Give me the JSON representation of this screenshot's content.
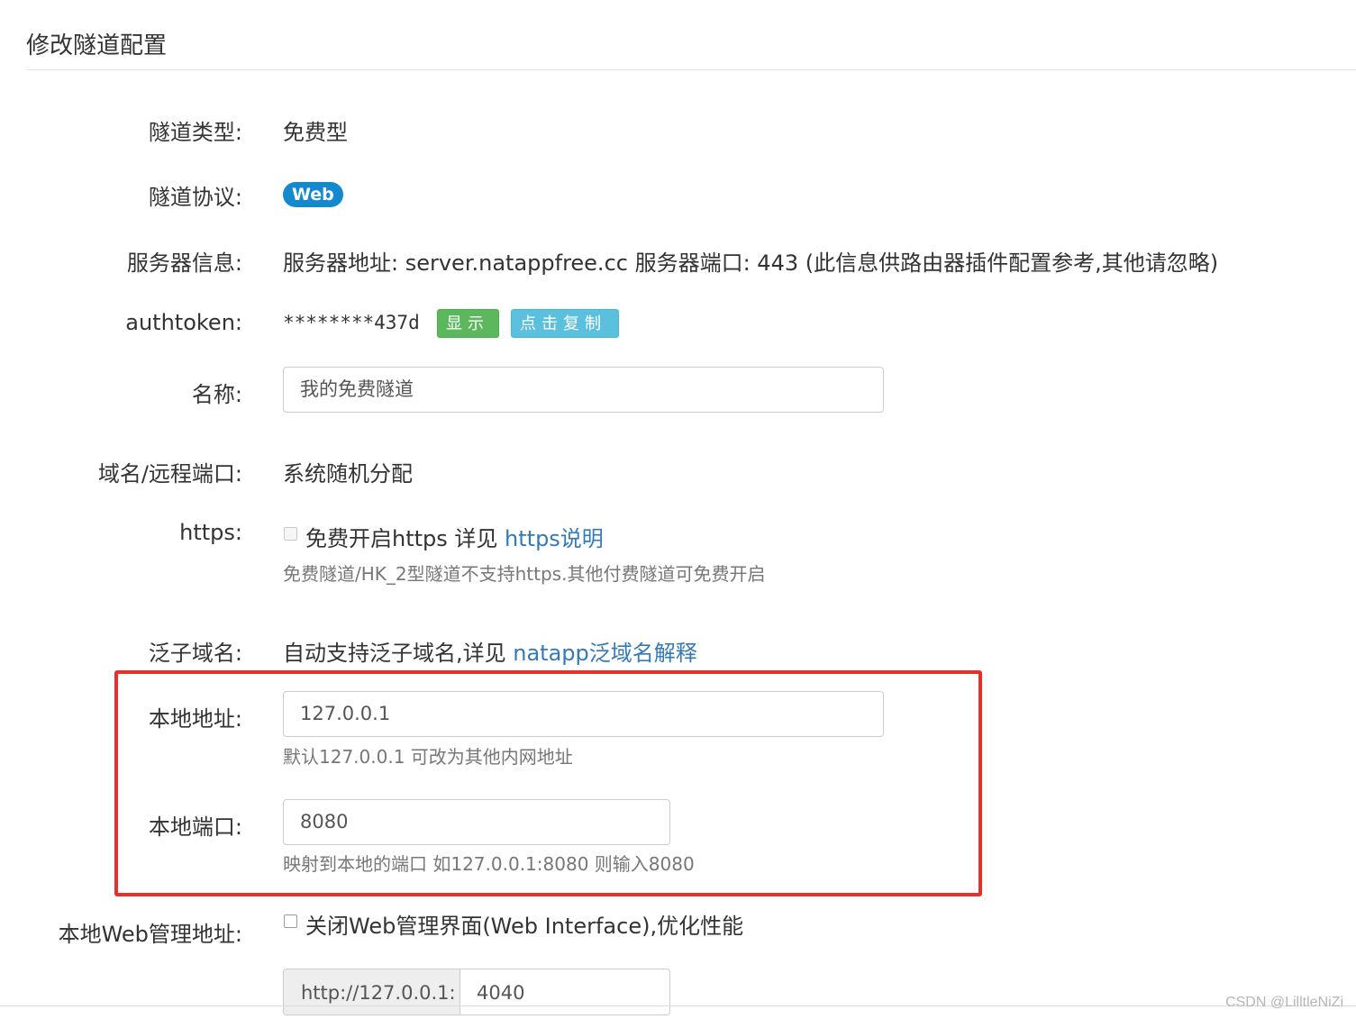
{
  "page": {
    "title": "修改隧道配置"
  },
  "rows": {
    "type": {
      "label": "隧道类型:",
      "value": "免费型"
    },
    "protocol": {
      "label": "隧道协议:",
      "badge": "Web"
    },
    "server": {
      "label": "服务器信息:",
      "value": "服务器地址: server.natappfree.cc 服务器端口: 443 (此信息供路由器插件配置参考,其他请忽略)"
    },
    "authtoken": {
      "label": "authtoken:",
      "value": "********437d",
      "show_button": "显示",
      "copy_button": "点击复制"
    },
    "name": {
      "label": "名称:",
      "value": "我的免费隧道"
    },
    "domain": {
      "label": "域名/远程端口:",
      "value": "系统随机分配"
    },
    "https": {
      "label": "https:",
      "checkbox_text": "免费开启https 详见 ",
      "link_text": "https说明",
      "help": "免费隧道/HK_2型隧道不支持https.其他付费隧道可免费开启"
    },
    "wildcard": {
      "label": "泛子域名:",
      "text": "自动支持泛子域名,详见 ",
      "link_text": "natapp泛域名解释"
    },
    "local_addr": {
      "label": "本地地址:",
      "value": "127.0.0.1",
      "help": "默认127.0.0.1 可改为其他内网地址"
    },
    "local_port": {
      "label": "本地端口:",
      "value": "8080",
      "help": "映射到本地的端口 如127.0.0.1:8080 则输入8080"
    },
    "web_admin": {
      "label": "本地Web管理地址:",
      "checkbox_text": "关闭Web管理界面(Web Interface),优化性能",
      "addon": "http://127.0.0.1:",
      "port_value": "4040"
    }
  },
  "watermark": "CSDN @LilltleNiZi",
  "colors": {
    "badge_web": "#1589cd",
    "btn_show": "#5cb85c",
    "btn_copy": "#5bc0de",
    "link": "#337ab7",
    "highlight_box": "#e8302b"
  }
}
